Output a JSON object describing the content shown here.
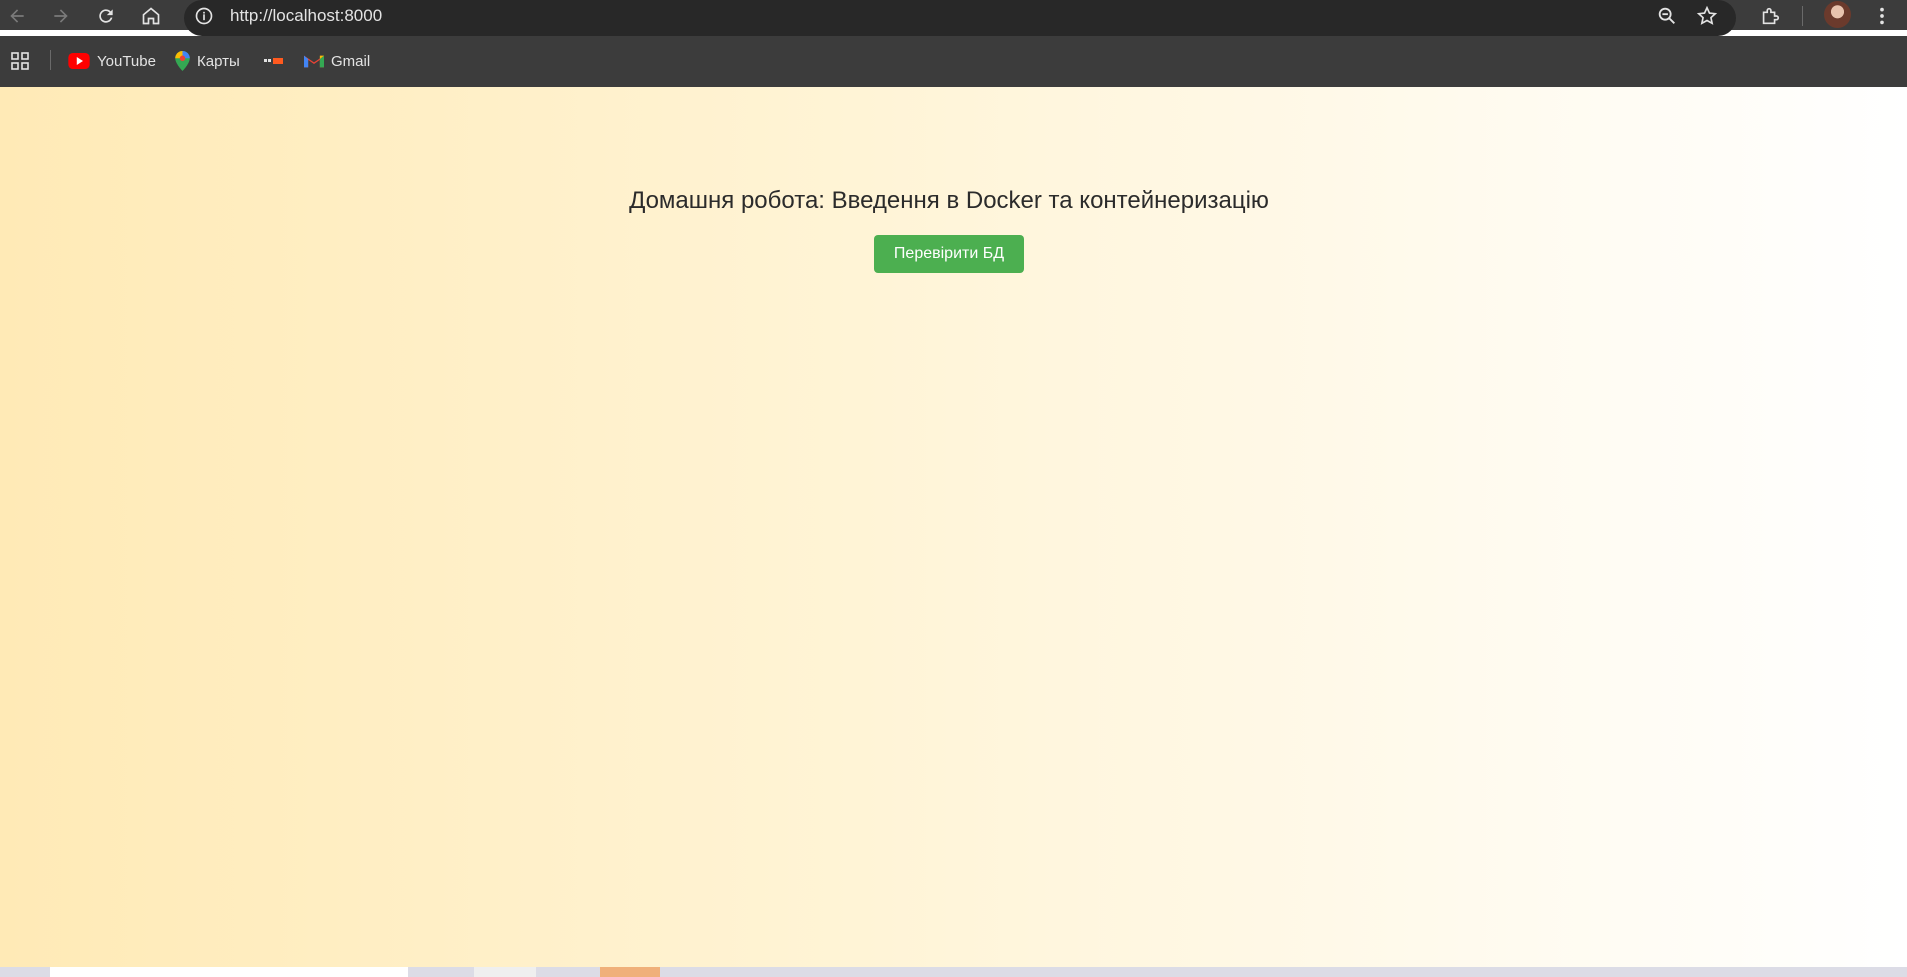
{
  "browser": {
    "url": "http://localhost:8000",
    "icons": [
      "back-icon",
      "forward-icon",
      "reload-icon",
      "home-icon",
      "info-icon",
      "zoom-icon",
      "star-icon",
      "extensions-icon",
      "menu-icon"
    ]
  },
  "bookmarks": {
    "items": [
      {
        "label": "YouTube",
        "icon": "youtube-icon"
      },
      {
        "label": "Карты",
        "icon": "maps-icon"
      },
      {
        "label": "",
        "icon": "bookmark-favicon-icon"
      },
      {
        "label": "Gmail",
        "icon": "gmail-icon"
      }
    ]
  },
  "page": {
    "title": "Домашня робота: Введення в Docker та контейнеризацію",
    "button_label": "Перевірити БД"
  },
  "colors": {
    "button": "#4caf50",
    "gradient_start": "#ffeab6",
    "gradient_end": "#ffffff",
    "toolbar": "#3c3c3c"
  }
}
